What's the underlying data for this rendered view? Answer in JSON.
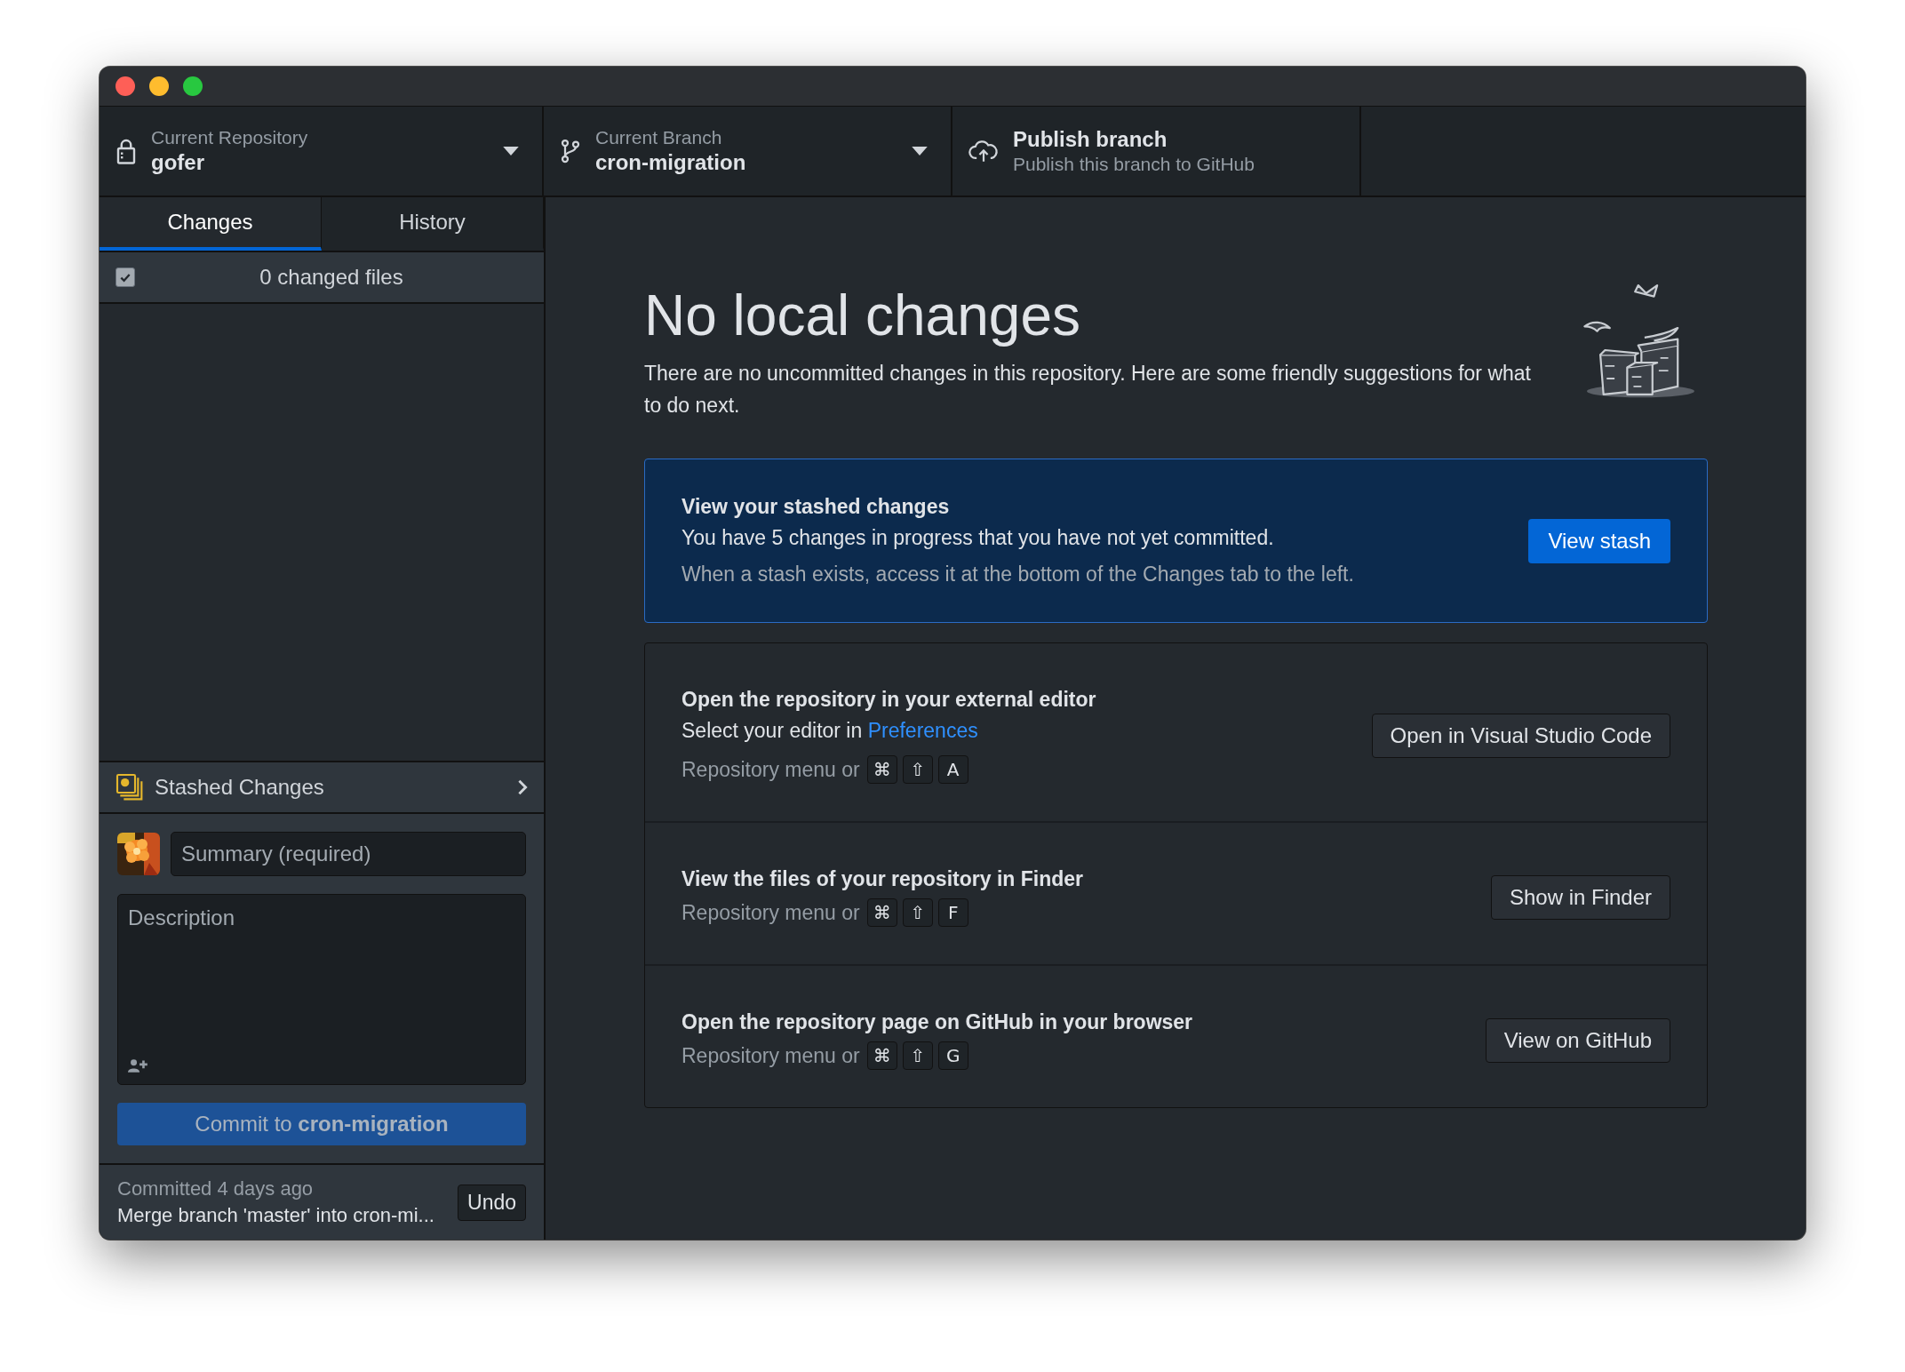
{
  "toolbar": [
    {
      "kind": "repository",
      "label": "Current Repository",
      "value": "gofer"
    },
    {
      "kind": "branch",
      "label": "Current Branch",
      "value": "cron-migration"
    },
    {
      "kind": "publish",
      "label": "Publish branch",
      "value": "Publish this branch to GitHub"
    }
  ],
  "tabs": [
    {
      "label": "Changes",
      "selected": true
    },
    {
      "label": "History",
      "selected": false
    }
  ],
  "changed_files": {
    "label": "0 changed files",
    "checked": true
  },
  "stashed_changes": {
    "label": "Stashed Changes"
  },
  "commit": {
    "summary_placeholder": "Summary (required)",
    "description_placeholder": "Description",
    "button": "Commit to **cron-migration**"
  },
  "last_commit": {
    "time": "Committed 4 days ago",
    "message": "Merge branch 'master' into cron-mi...",
    "undo": "Undo"
  },
  "main": {
    "title": "No local changes",
    "description": "There are no uncommitted changes in this repository. Here are some friendly suggestions for what to do next.",
    "stash_card": {
      "title": "View your stashed changes",
      "text": "You have 5 changes in progress that you have not yet committed.",
      "hint": "When a stash exists, access it at the bottom of the Changes tab to the left.",
      "button": "View stash"
    },
    "suggestions": [
      {
        "title": "Open the repository in your external editor",
        "text": "Select your editor in ",
        "link": "Preferences",
        "shortcut_prefix": "Repository menu or",
        "keys": [
          "⌘",
          "⇧",
          "A"
        ],
        "button": "Open in Visual Studio Code"
      },
      {
        "title": "View the files of your repository in Finder",
        "shortcut_prefix": "Repository menu or",
        "keys": [
          "⌘",
          "⇧",
          "F"
        ],
        "button": "Show in Finder"
      },
      {
        "title": "Open the repository page on GitHub in your browser",
        "shortcut_prefix": "Repository menu or",
        "keys": [
          "⌘",
          "⇧",
          "G"
        ],
        "button": "View on GitHub"
      }
    ]
  }
}
